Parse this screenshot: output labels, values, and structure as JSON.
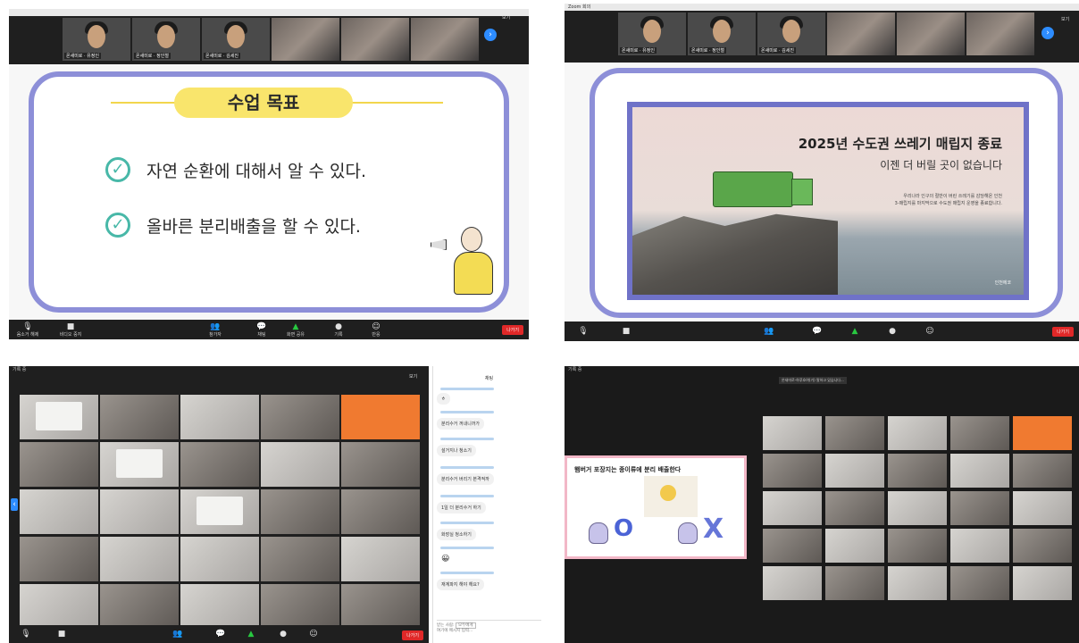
{
  "panel1": {
    "topbar_title": "",
    "gallery": [
      {
        "caption": "온새미로 · 유정인"
      },
      {
        "caption": "온새미로 · 정인철"
      },
      {
        "caption": "온새미로 · 김세진"
      },
      {
        "caption": ""
      },
      {
        "caption": ""
      },
      {
        "caption": ""
      }
    ],
    "view_label": "보기",
    "slide": {
      "goal_title": "수업 목표",
      "goals": [
        "자연 순환에 대해서 알 수 있다.",
        "올바른 분리배출을 할 수 있다."
      ]
    },
    "controls": [
      {
        "label": "음소거 해제",
        "icon": "microphone-icon"
      },
      {
        "label": "비디오 중지",
        "icon": "video-camera-icon"
      },
      {
        "label": "참가자",
        "icon": "participants-icon"
      },
      {
        "label": "채팅",
        "icon": "chat-icon"
      },
      {
        "label": "화면 공유",
        "icon": "share-screen-icon"
      },
      {
        "label": "기록",
        "icon": "record-icon"
      },
      {
        "label": "반응",
        "icon": "reactions-icon"
      }
    ],
    "leave_label": "나가기"
  },
  "panel2": {
    "topbar_title": "Zoom 회의",
    "gallery": [
      {
        "caption": "온새미로 · 유정인"
      },
      {
        "caption": "온새미로 · 정인철"
      },
      {
        "caption": "온새미로 · 김세진"
      },
      {
        "caption": ""
      },
      {
        "caption": ""
      },
      {
        "caption": ""
      }
    ],
    "view_label": "보기",
    "poster": {
      "title": "2025년 수도권 쓰레기 매립지 종료",
      "subtitle": "이젠 더 버릴 곳이 없습니다",
      "small_text_1": "우리나라 인구의 절반이 버린 쓰레기를 감당해온 인천",
      "small_text_2": "3-매립지를 마지막으로 수도권 매립지 운영을 종료합니다.",
      "brand": "인천에코"
    },
    "leave_label": "나가기"
  },
  "panel3": {
    "topbar_title": "기록 중",
    "view_label": "보기",
    "chat": {
      "title": "채팅",
      "messages": [
        "ㅎ",
        "분리수거 꺼내니까가",
        "설거지나 청소기",
        "분리수거 버리기 본격적까",
        "1일 더 분리수거 하기",
        "화장실 청소하기",
        "😀",
        "재계파지 해야 해요?"
      ],
      "recipient_label": "받는 사람:",
      "recipient_value": "모두에게",
      "input_placeholder": "여기에 메시지 입력..."
    },
    "leave_label": "나가기"
  },
  "panel4": {
    "topbar_title": "기록 중",
    "top_note": "온새미로-하루호여(가) 말하고 있습니다...",
    "card": {
      "title": "햄버거 포장지는 종이류에 분리 배출한다",
      "o_mark": "O",
      "x_mark": "X"
    }
  }
}
